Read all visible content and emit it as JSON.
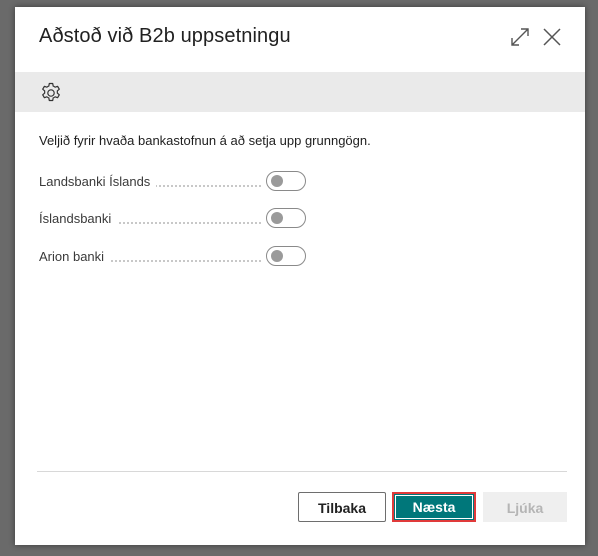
{
  "dialog": {
    "title": "Aðstoð við B2b uppsetningu",
    "expand_icon": "expand-icon",
    "close_icon": "close-icon"
  },
  "toolbar": {
    "settings_icon": "gear-icon"
  },
  "content": {
    "instruction": "Veljið fyrir hvaða bankastofnun á að setja upp grunngögn.",
    "banks": [
      {
        "label": "Landsbanki Íslands",
        "enabled": false
      },
      {
        "label": "Íslandsbanki",
        "enabled": false
      },
      {
        "label": "Arion banki",
        "enabled": false
      }
    ]
  },
  "footer": {
    "back_label": "Tilbaka",
    "next_label": "Næsta",
    "finish_label": "Ljúka",
    "finish_disabled": true
  },
  "colors": {
    "primary": "#00777a",
    "highlight_border": "#e03a3a",
    "toolbar_bg": "#eaeaea",
    "disabled_bg": "#efefef"
  }
}
